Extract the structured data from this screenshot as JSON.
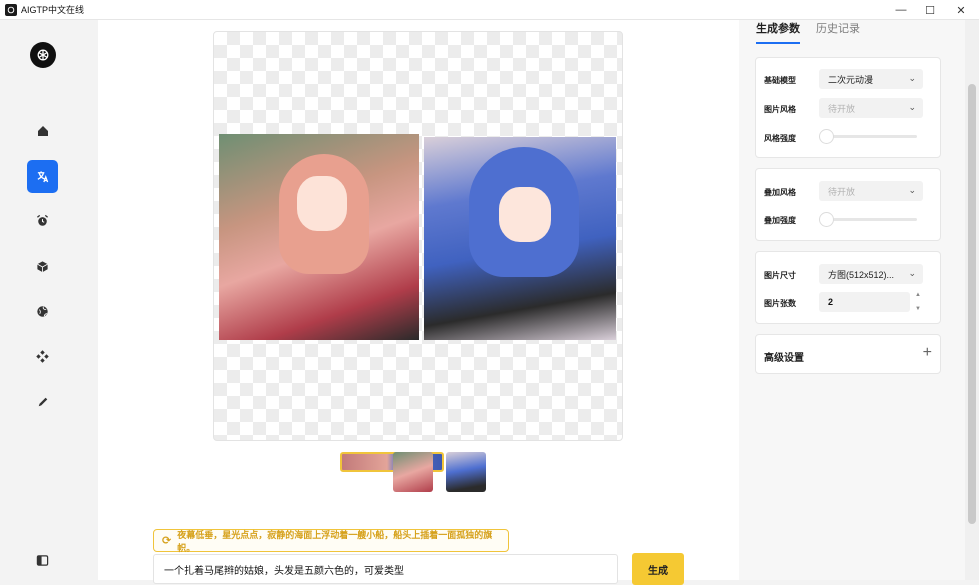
{
  "window": {
    "title": "AIGTP中文在线",
    "min": "—",
    "max": "☐",
    "close": "✕"
  },
  "sidebar": {
    "items": [
      {
        "name": "home-icon",
        "glyph": "⌂"
      },
      {
        "name": "translate-icon",
        "glyph": "文"
      },
      {
        "name": "alarm-icon",
        "glyph": "⏰"
      },
      {
        "name": "cube-icon",
        "glyph": "◆"
      },
      {
        "name": "globe-icon",
        "glyph": "◍"
      },
      {
        "name": "gamepad-icon",
        "glyph": "✥"
      },
      {
        "name": "pen-icon",
        "glyph": "✎"
      }
    ],
    "toggle_glyph": "◧"
  },
  "main": {
    "hint_text": "夜幕低垂，星光点点，寂静的海面上浮动着一艘小船，船头上插着一面孤独的旗帜。",
    "prompt_value": "一个扎着马尾辫的姑娘，头发是五颜六色的，可爱类型",
    "generate_label": "生成"
  },
  "right": {
    "tabs": [
      "生成参数",
      "历史记录"
    ],
    "base_model_label": "基础模型",
    "base_model_value": "二次元动漫",
    "style_label": "图片风格",
    "style_value": "待开放",
    "style_strength_label": "风格强度",
    "overlay_style_label": "叠加风格",
    "overlay_style_value": "待开放",
    "overlay_strength_label": "叠加强度",
    "size_label": "图片尺寸",
    "size_value": "方图(512x512)...",
    "count_label": "图片张数",
    "count_value": "2",
    "advanced_label": "高级设置",
    "plus": "+",
    "chevron": "⌄",
    "up": "▲",
    "down": "▼"
  },
  "colors": {
    "accent": "#1c6ef2",
    "generate": "#f5c933",
    "hint": "#d6a11b"
  }
}
